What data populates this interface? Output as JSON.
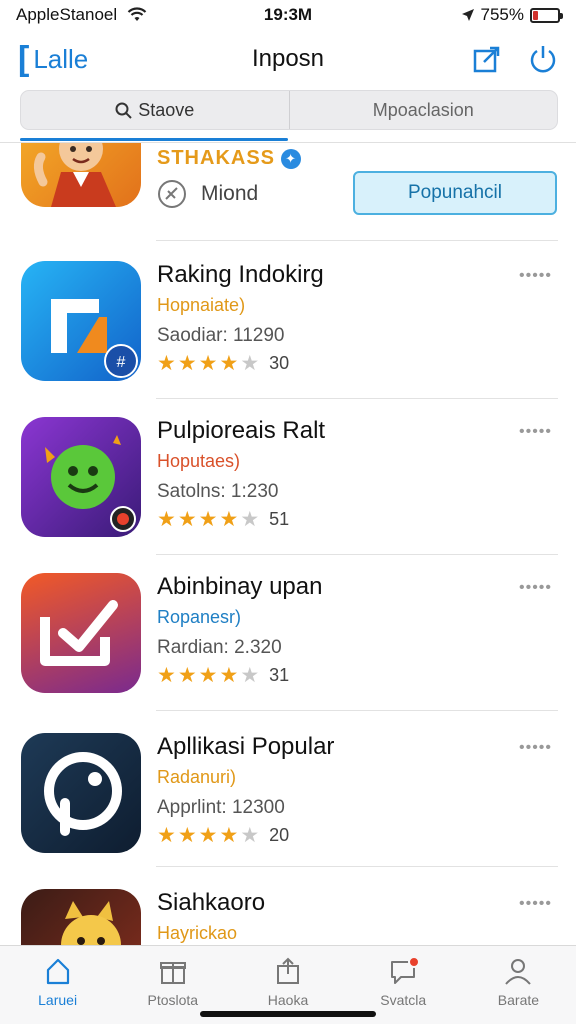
{
  "status": {
    "carrier": "AppleStanoel",
    "time": "19:3M",
    "battery_text": "755%",
    "battery_level": 0.2
  },
  "nav": {
    "back_label": "Lalle",
    "title": "Inposn",
    "share_icon": "share-icon",
    "power_icon": "power-icon"
  },
  "segments": [
    {
      "label": "Staove",
      "icon": "search-icon"
    },
    {
      "label": "Mpoaclasion"
    }
  ],
  "first_app": {
    "name": "STHAKASS",
    "meta_label": "Miond",
    "button_label": "Popunahcil",
    "icon_colors": [
      "#f39a1a",
      "#c93b1e"
    ]
  },
  "apps": [
    {
      "name": "Raking Indokirg",
      "subtitle": "Hopnaiate)",
      "subtitle_color": "#e09818",
      "meta": "Saodiar: 11290",
      "stars": 4,
      "count": "30",
      "icon_colors": [
        "#1da6f0",
        "#1160c4"
      ],
      "icon": "app-icon-blue"
    },
    {
      "name": "Pulpioreais Ralt",
      "subtitle": "Hoputaes)",
      "subtitle_color": "#d9512a",
      "meta": "Satolns: 1:230",
      "stars": 4,
      "count": "51",
      "icon_colors": [
        "#8a35d0",
        "#2c1a6e"
      ],
      "icon": "app-icon-purple"
    },
    {
      "name": "Abinbinay upan",
      "subtitle": "Ropanesr)",
      "subtitle_color": "#1f7fc4",
      "meta": "Rardian: 2.320",
      "stars": 4,
      "count": "31",
      "icon_colors": [
        "#f0572a",
        "#6a1c8a"
      ],
      "icon": "app-icon-orange"
    },
    {
      "name": "Apllikasi Popular",
      "subtitle": "Radanuri)",
      "subtitle_color": "#e09818",
      "meta": "Apprlint: 12300",
      "stars": 4,
      "count": "20",
      "icon_colors": [
        "#1c3550",
        "#0f1f33"
      ],
      "icon": "app-icon-navy"
    },
    {
      "name": "Siahkaoro",
      "subtitle": "Hayrickao",
      "subtitle_color": "#e09818",
      "meta": "",
      "stars": 0,
      "count": "",
      "icon_colors": [
        "#3a1d17",
        "#7a2a1d"
      ],
      "icon": "app-icon-dark"
    }
  ],
  "more_label": "•••••",
  "tabs": [
    {
      "label": "Laruei",
      "icon": "home-icon",
      "active": true
    },
    {
      "label": "Ptoslota",
      "icon": "gift-icon",
      "active": false
    },
    {
      "label": "Haoka",
      "icon": "share-box-icon",
      "active": false
    },
    {
      "label": "Svatcla",
      "icon": "chat-icon",
      "active": false,
      "badge": true
    },
    {
      "label": "Barate",
      "icon": "person-icon",
      "active": false
    }
  ],
  "colors": {
    "accent": "#1a7fd6",
    "star": "#f0a017",
    "get_button_bg": "#d8f1fb"
  }
}
